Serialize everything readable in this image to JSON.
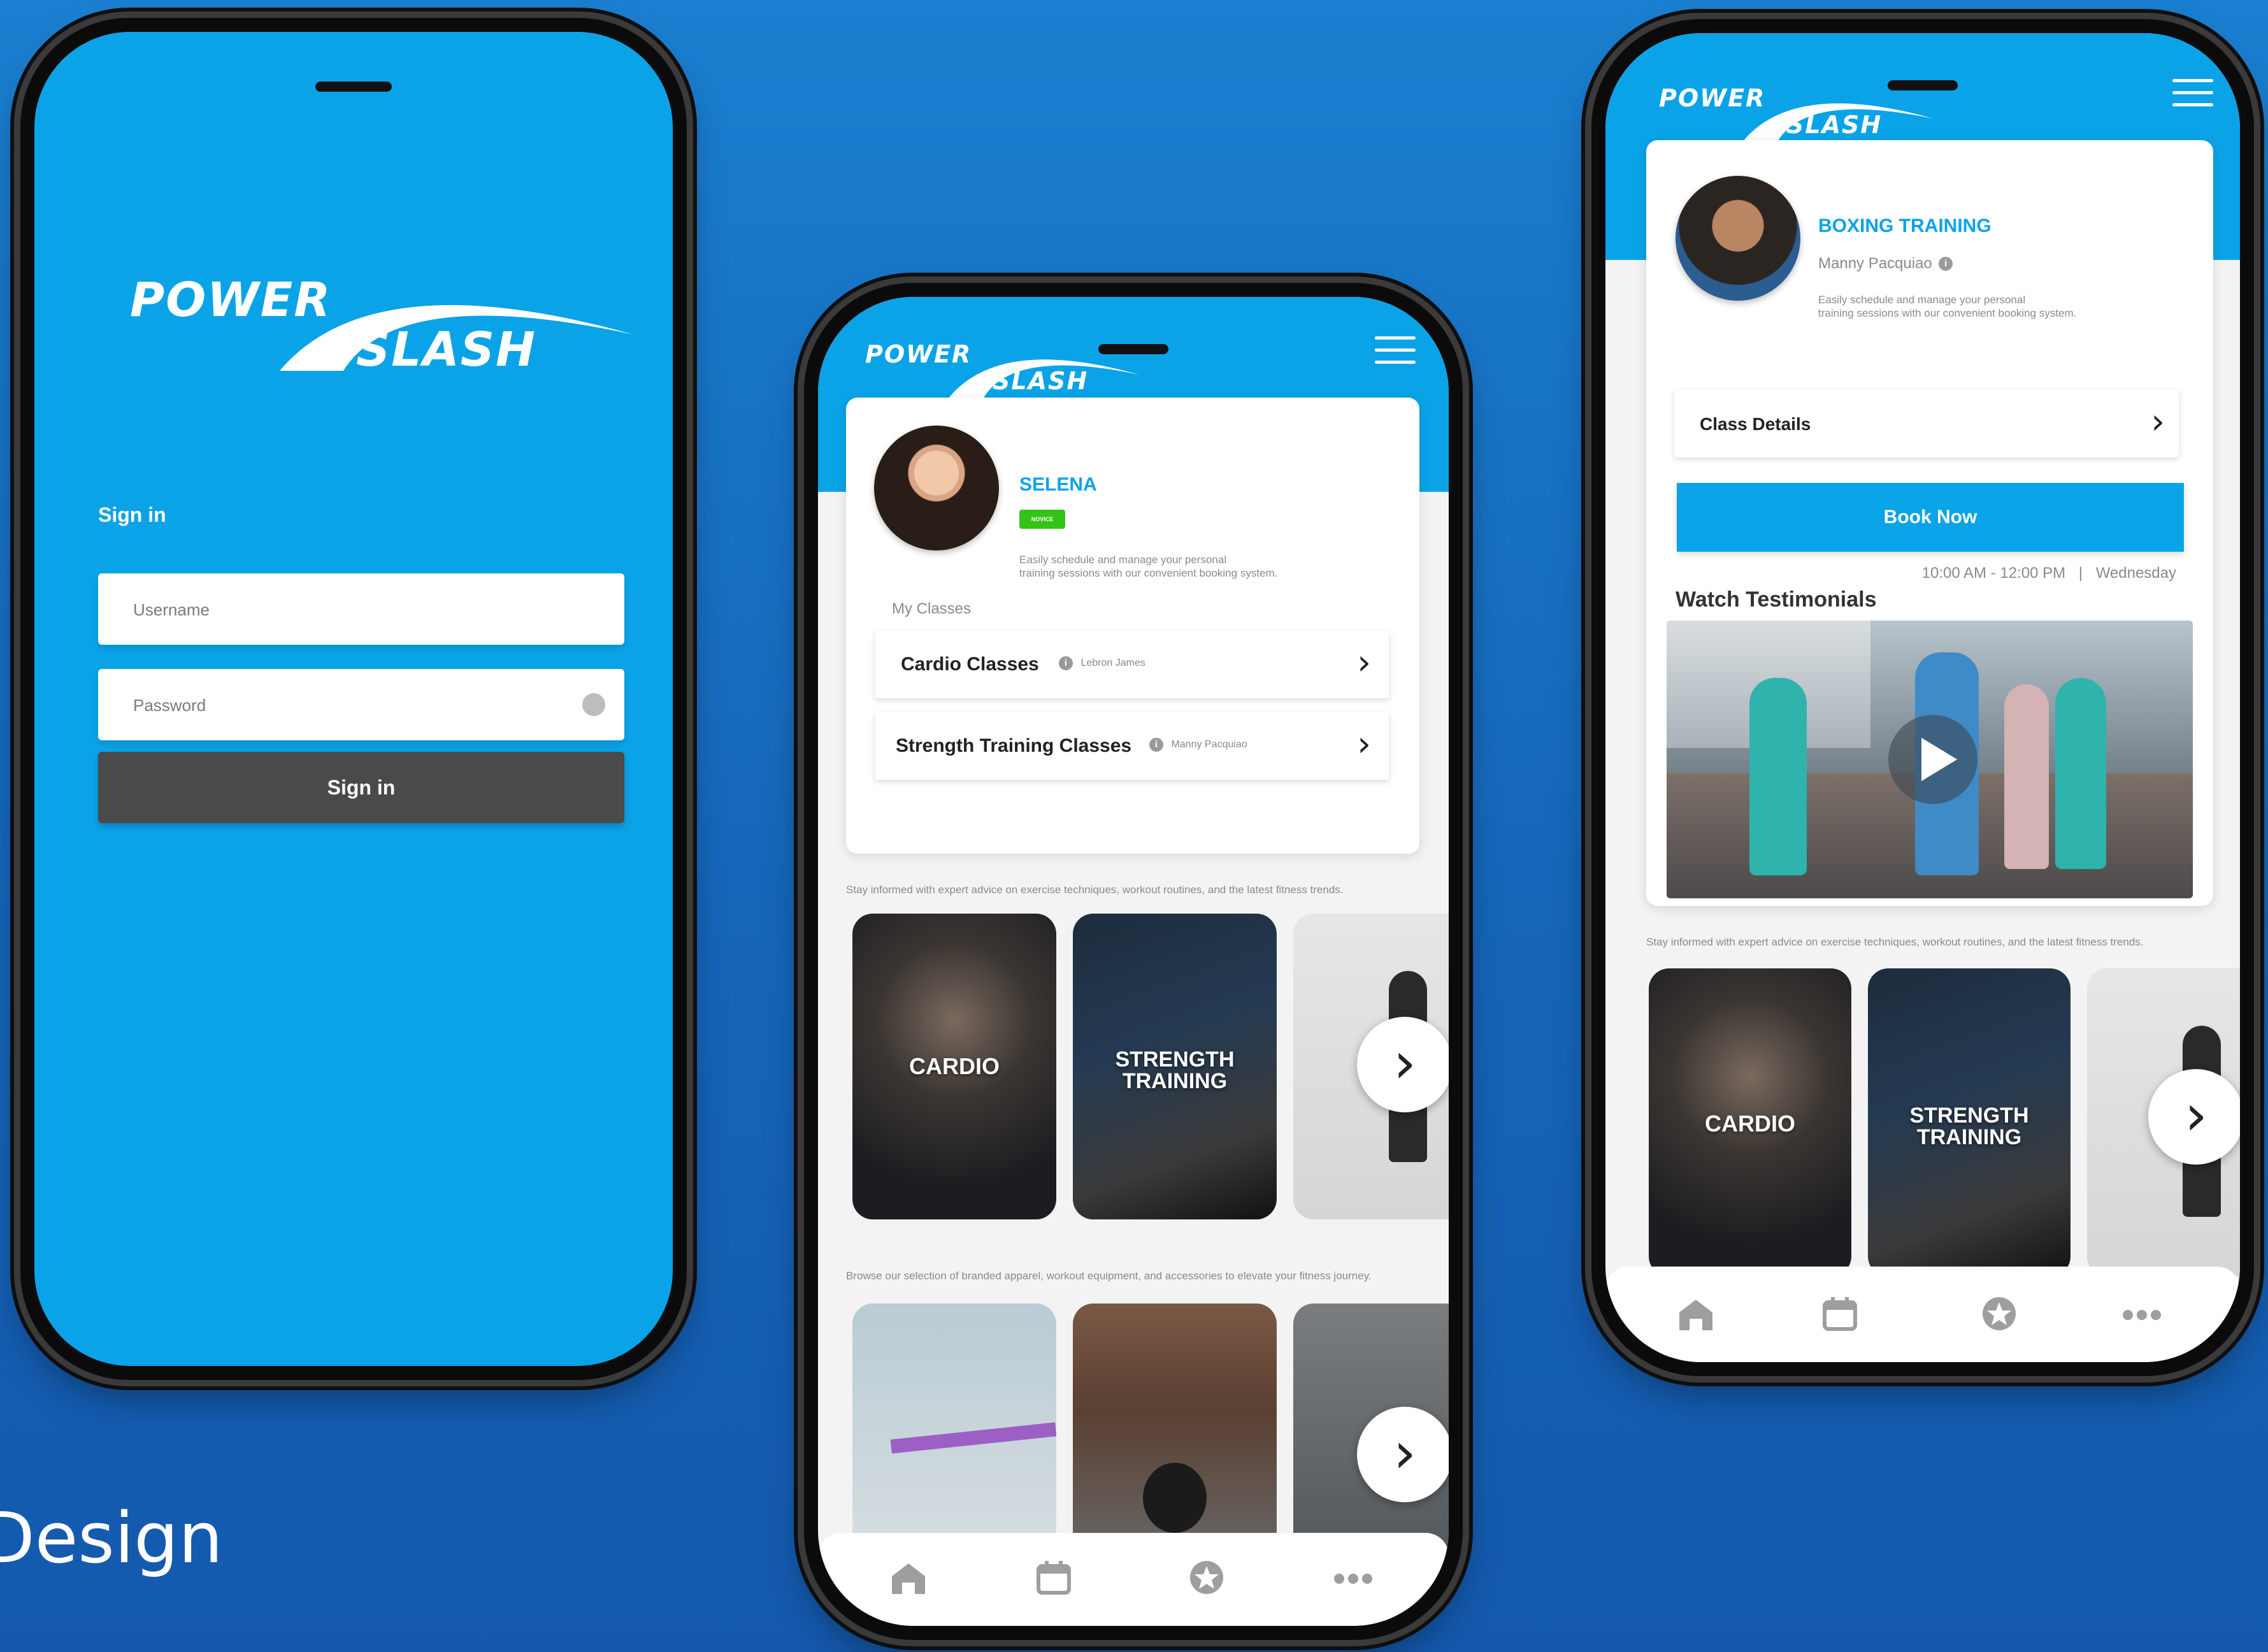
{
  "brand": {
    "word1": "POWER",
    "word2": "SLASH"
  },
  "caption": "Design",
  "login": {
    "title": "Sign in",
    "username_placeholder": "Username",
    "password_placeholder": "Password",
    "button": "Sign in"
  },
  "profile": {
    "name": "SELENA",
    "badge": "NOVICE",
    "desc_line1": "Easily schedule and manage your personal",
    "desc_line2": "training sessions with our convenient booking system.",
    "my_classes_label": "My Classes",
    "classes": [
      {
        "title": "Cardio Classes",
        "coach": "Lebron James"
      },
      {
        "title": "Strength Training Classes",
        "coach": "Manny Pacquiao"
      }
    ],
    "section_advice": "Stay informed with expert advice on exercise techniques, workout routines, and the latest fitness trends.",
    "section_shop": "Browse our selection of branded apparel, workout equipment, and accessories to elevate your fitness journey.",
    "tiles": [
      "CARDIO",
      "STRENGTH",
      "TRAINING"
    ]
  },
  "detail": {
    "title": "BOXING TRAINING",
    "coach": "Manny Pacquiao",
    "desc_line1": "Easily schedule and manage your personal",
    "desc_line2": "training sessions with our convenient booking system.",
    "class_details": "Class Details",
    "book_now": "Book Now",
    "time": "10:00 AM - 12:00 PM",
    "separator": "|",
    "day": "Wednesday",
    "testimonials": "Watch Testimonials",
    "section_advice": "Stay informed with expert advice on exercise techniques, workout routines, and the latest fitness trends."
  },
  "nav_icons": [
    "home-icon",
    "calendar-icon",
    "star-badge-icon",
    "more-dots-icon"
  ]
}
